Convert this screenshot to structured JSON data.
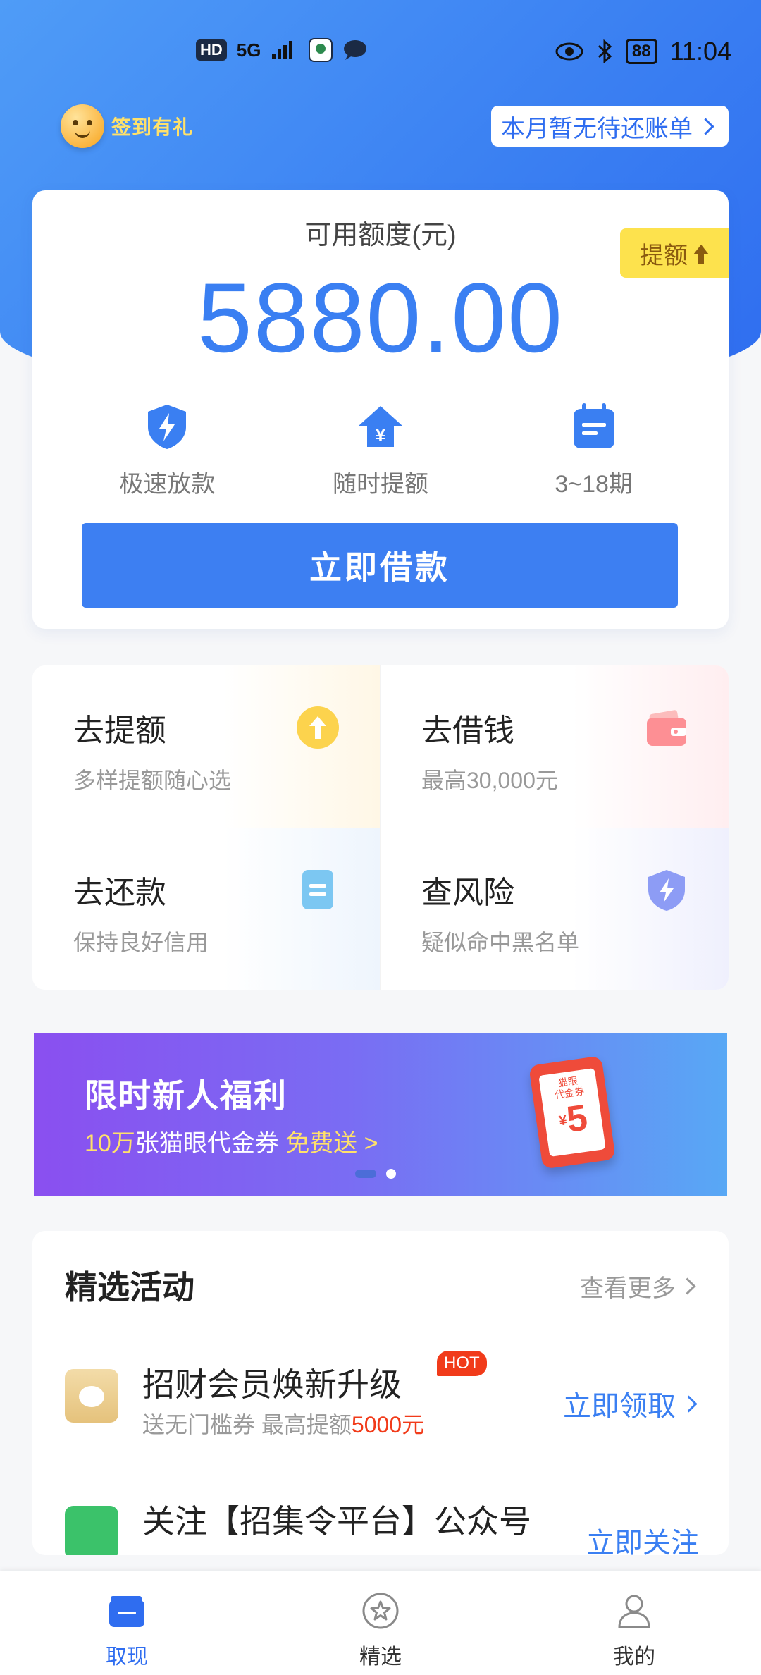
{
  "status_bar": {
    "hd": "HD",
    "net": "5G",
    "battery": "88",
    "time": "11:04"
  },
  "header": {
    "signin_label": "签到有礼",
    "bill_label": "本月暂无待还账单"
  },
  "credit": {
    "label": "可用额度(元)",
    "amount": "5880.00",
    "raise_label": "提额",
    "features": [
      {
        "icon": "shield-bolt-icon",
        "label": "极速放款"
      },
      {
        "icon": "yuan-house-icon",
        "label": "随时提额"
      },
      {
        "icon": "calendar-icon",
        "label": "3~18期"
      }
    ],
    "borrow_button": "立即借款"
  },
  "quick_grid": [
    {
      "title": "去提额",
      "sub": "多样提额随心选",
      "icon": "arrow-up-circle-icon"
    },
    {
      "title": "去借钱",
      "sub": "最高30,000元",
      "icon": "wallet-icon"
    },
    {
      "title": "去还款",
      "sub": "保持良好信用",
      "icon": "document-icon"
    },
    {
      "title": "查风险",
      "sub": "疑似命中黑名单",
      "icon": "shield-icon"
    }
  ],
  "banner": {
    "title": "限时新人福利",
    "sub_prefix": "10万",
    "sub_main": "张猫眼代金券",
    "sub_highlight": "免费送 >",
    "coupon_label": "猫眼\n代金券",
    "coupon_value": "5",
    "coupon_currency": "¥"
  },
  "activities": {
    "title": "精选活动",
    "more": "查看更多",
    "items": [
      {
        "name": "招财会员焕新升级",
        "badge": "HOT",
        "desc_prefix": "送无门槛券  最高提额",
        "desc_highlight": "5000元",
        "cta": "立即领取"
      },
      {
        "name": "关注【招集令平台】公众号",
        "cta": "立即关注"
      }
    ]
  },
  "bottom_nav": [
    {
      "label": "取现",
      "icon": "wallet-icon",
      "active": true
    },
    {
      "label": "精选",
      "icon": "star-circle-icon",
      "active": false
    },
    {
      "label": "我的",
      "icon": "user-icon",
      "active": false
    }
  ],
  "colors": {
    "primary": "#3a7ff2",
    "accent_yellow": "#fde24d",
    "hot_red": "#f13b1a"
  }
}
